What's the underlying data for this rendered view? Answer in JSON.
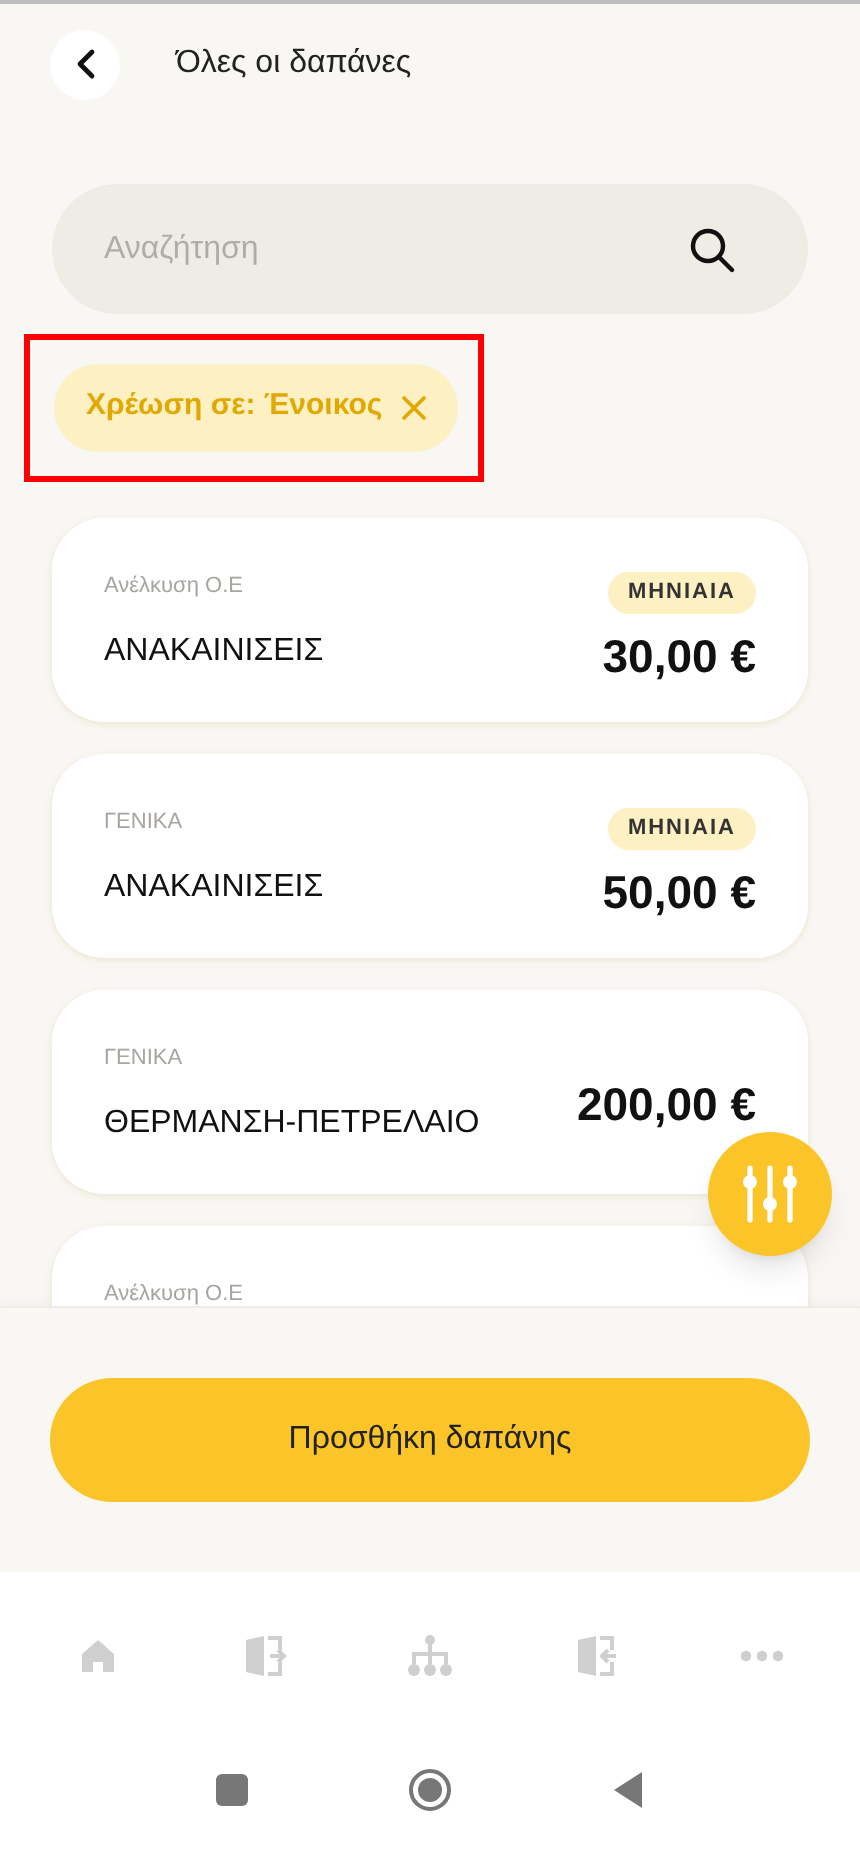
{
  "header": {
    "title": "Όλες οι δαπάνες"
  },
  "search": {
    "placeholder": "Αναζήτηση"
  },
  "filter_chip": {
    "label": "Χρέωση σε: Ένοικος",
    "highlighted": true
  },
  "expenses": [
    {
      "category": "Ανέλκυση Ο.Ε",
      "name": "ΑΝΑΚΑΙΝΙΣΕΙΣ",
      "badge": "ΜΗΝΙΑΙΑ",
      "amount": "30,00 €"
    },
    {
      "category": "ΓΕΝΙΚΑ",
      "name": "ΑΝΑΚΑΙΝΙΣΕΙΣ",
      "badge": "ΜΗΝΙΑΙΑ",
      "amount": "50,00 €"
    },
    {
      "category": "ΓΕΝΙΚΑ",
      "name": "ΘΕΡΜΑΝΣΗ-ΠΕΤΡΕΛΑΙΟ",
      "amount": "200,00 €"
    },
    {
      "category": "Ανέλκυση Ο.Ε"
    }
  ],
  "add_button": {
    "label": "Προσθήκη δαπάνης"
  },
  "bottom_nav": [
    {
      "kind": "home"
    },
    {
      "kind": "exit"
    },
    {
      "kind": "tree"
    },
    {
      "kind": "enter"
    },
    {
      "kind": "more"
    }
  ]
}
